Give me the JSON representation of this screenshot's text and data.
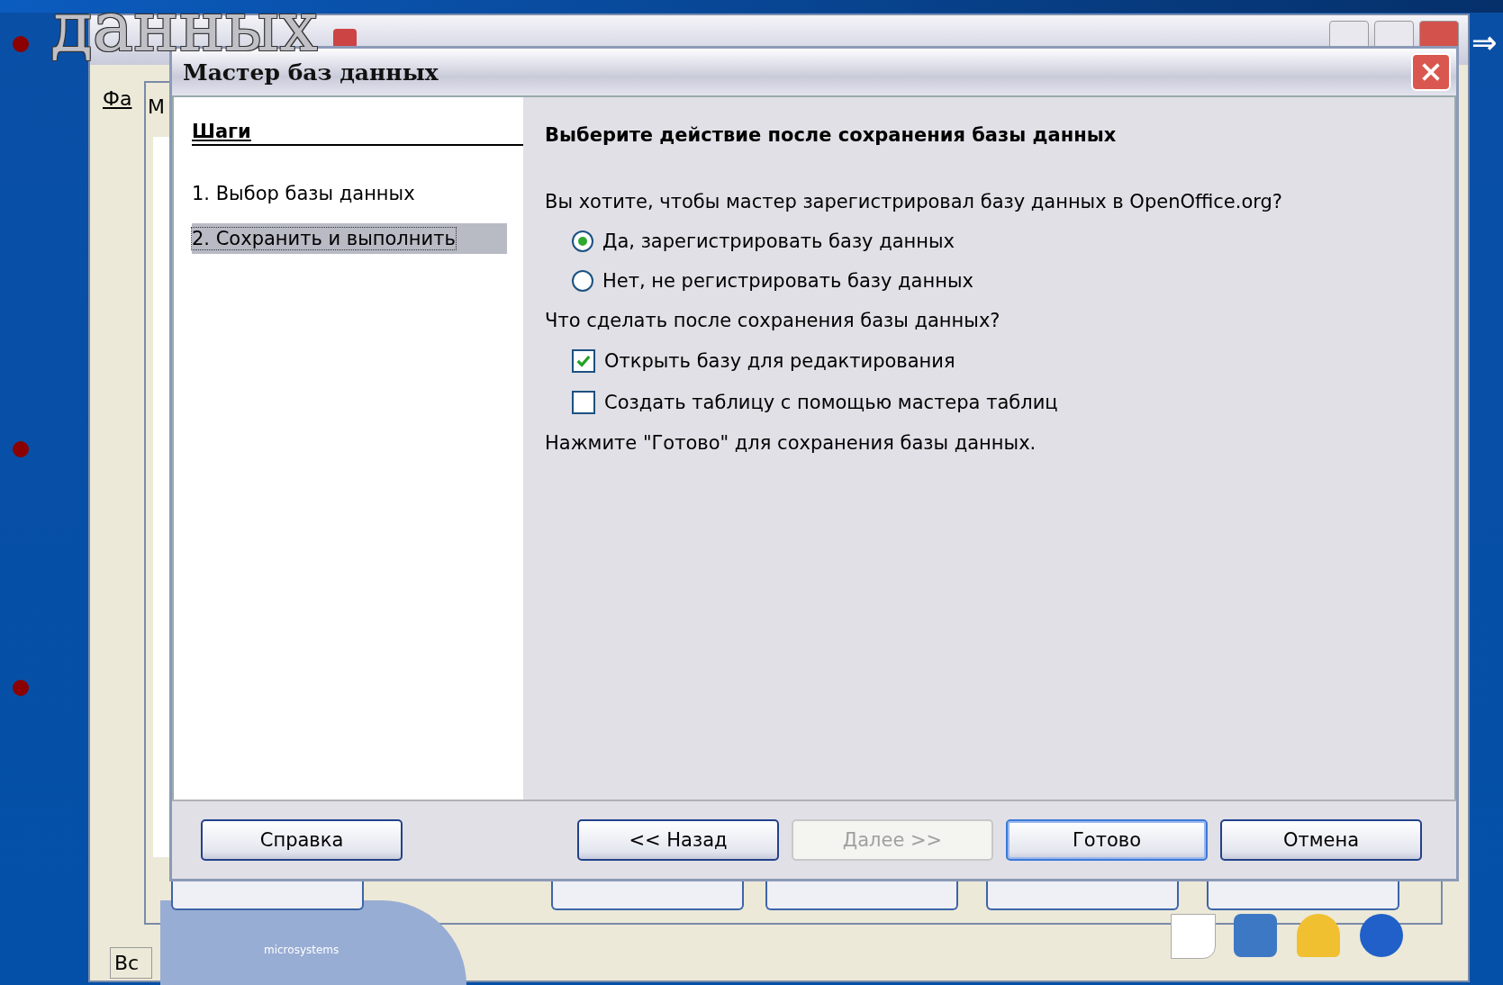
{
  "slide": {
    "heading_fragment": "данных",
    "arrow": "⇒"
  },
  "background_window": {
    "menu_fragment": "Фа",
    "dialog_title_fragment": "М",
    "status_fragment": "Вс",
    "logo_caption": "microsystems"
  },
  "dialog": {
    "title": "Мастер баз данных",
    "steps_heading": "Шаги",
    "steps": [
      {
        "label": "1. Выбор базы данных",
        "selected": false
      },
      {
        "label": "2. Сохранить и выполнить",
        "selected": true
      }
    ],
    "heading": "Выберите действие после сохранения базы данных",
    "items": [
      {
        "kind": "text",
        "label": "Вы хотите, чтобы мастер зарегистрировал базу данных в OpenOffice.org?"
      },
      {
        "kind": "radio",
        "label": "Да, зарегистрировать базу данных",
        "selected": true
      },
      {
        "kind": "radio",
        "label": "Нет, не регистрировать базу данных",
        "selected": false
      },
      {
        "kind": "text",
        "label": "Что сделать после сохранения базы данных?"
      },
      {
        "kind": "checkbox",
        "label": "Открыть базу для редактирования",
        "checked": true
      },
      {
        "kind": "checkbox",
        "label": "Создать таблицу с помощью мастера таблиц",
        "checked": false
      },
      {
        "kind": "text",
        "label": "Нажмите \"Готово\" для сохранения базы данных."
      }
    ],
    "help_button": {
      "label": "Справка",
      "disabled": false
    },
    "nav_buttons": [
      {
        "label": "<< Назад",
        "disabled": false,
        "default": false
      },
      {
        "label": "Далее >>",
        "disabled": true,
        "default": false
      },
      {
        "label": "Готово",
        "disabled": false,
        "default": true
      },
      {
        "label": "Отмена",
        "disabled": false,
        "default": false
      }
    ]
  }
}
